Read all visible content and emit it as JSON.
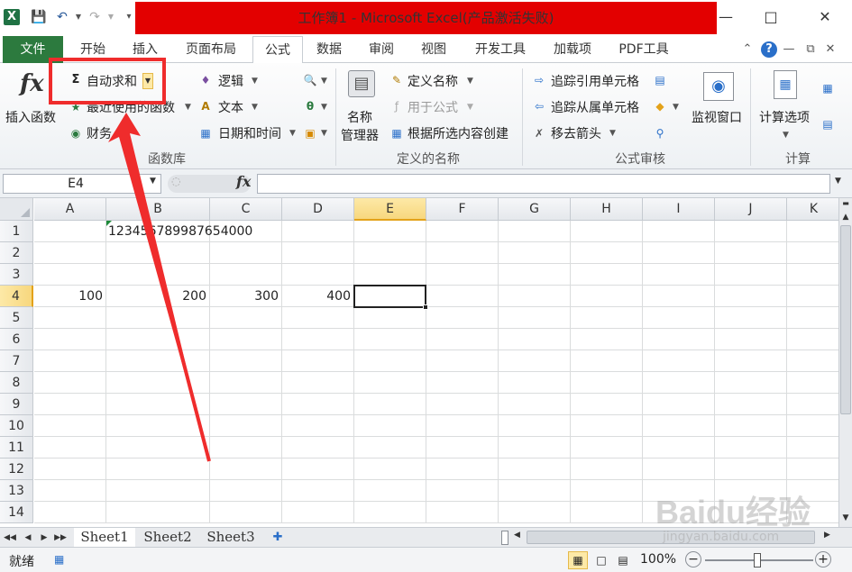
{
  "window": {
    "title": "工作簿1 - Microsoft Excel(产品激活失败)",
    "app_icon": "X"
  },
  "tabs": {
    "file": "文件",
    "items": [
      "开始",
      "插入",
      "页面布局",
      "公式",
      "数据",
      "审阅",
      "视图",
      "开发工具",
      "加载项",
      "PDF工具"
    ],
    "active_index": 3
  },
  "ribbon": {
    "insert_function": {
      "icon": "fx",
      "label": "插入函数"
    },
    "library": {
      "autosum": "自动求和",
      "recent": "最近使用的函数",
      "finance": "财务",
      "logic": "逻辑",
      "text": "文本",
      "datetime": "日期和时间",
      "group_label": "函数库"
    },
    "names": {
      "name_manager_line1": "名称",
      "name_manager_line2": "管理器",
      "define_name": "定义名称",
      "use_in_formula": "用于公式",
      "create_from_selection": "根据所选内容创建",
      "group_label": "定义的名称"
    },
    "audit": {
      "trace_precedents": "追踪引用单元格",
      "trace_dependents": "追踪从属单元格",
      "remove_arrows": "移去箭头",
      "watch_window": "监视窗口",
      "group_label": "公式审核"
    },
    "calc": {
      "calc_options": "计算选项",
      "group_label": "计算"
    }
  },
  "formula_bar": {
    "name_box": "E4",
    "fx_label": "fx",
    "formula": ""
  },
  "grid": {
    "columns": [
      "A",
      "B",
      "C",
      "D",
      "E",
      "F",
      "G",
      "H",
      "I",
      "J",
      "K"
    ],
    "rows": [
      "1",
      "2",
      "3",
      "4",
      "5",
      "6",
      "7",
      "8",
      "9",
      "10",
      "11",
      "12",
      "13",
      "14"
    ],
    "selected_column": "E",
    "selected_row": "4",
    "cells": {
      "B1": "12345678998765400​0",
      "A4": "100",
      "B4": "200",
      "C4": "300",
      "D4": "400"
    }
  },
  "sheets": [
    "Sheet1",
    "Sheet2",
    "Sheet3"
  ],
  "active_sheet": 0,
  "status": {
    "ready": "就绪",
    "zoom": "100%"
  },
  "watermark": {
    "brand": "Baidu经验",
    "url": "jingyan.baidu.com"
  },
  "colors": {
    "file_tab": "#2c7a3e",
    "annotation": "#ef2c2c",
    "selected_header": "#f7d77e",
    "title_band": "#e30000"
  }
}
